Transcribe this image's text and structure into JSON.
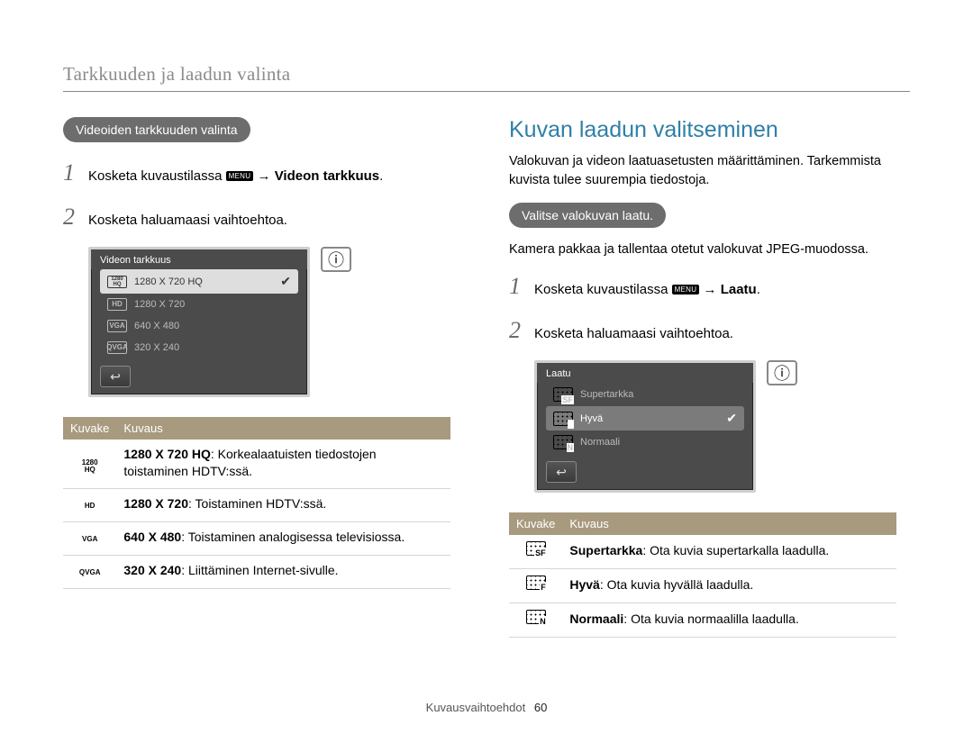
{
  "breadcrumb": "Tarkkuuden ja laadun valinta",
  "left": {
    "pill": "Videoiden tarkkuuden valinta",
    "step1_pre": "Kosketa kuvaustilassa ",
    "step1_menu": "MENU",
    "step1_post": " → ",
    "step1_bold": "Videon tarkkuus",
    "step1_end": ".",
    "step2": "Kosketa haluamaasi vaihtoehtoa.",
    "mock": {
      "title": "Videon tarkkuus",
      "rows": [
        {
          "icon_top": "1280",
          "icon_bot": "HQ",
          "label": "1280 X 720 HQ",
          "selected": true,
          "check": true
        },
        {
          "icon": "HD",
          "label": "1280 X 720"
        },
        {
          "icon": "VGA",
          "label": "640 X 480"
        },
        {
          "icon": "QVGA",
          "label": "320 X 240"
        }
      ]
    },
    "table": {
      "th_icon": "Kuvake",
      "th_desc": "Kuvaus",
      "rows": [
        {
          "icon_top": "1280",
          "icon_bot": "HQ",
          "bold": "1280 X 720 HQ",
          "rest": ": Korkealaatuisten tiedostojen toistaminen HDTV:ssä."
        },
        {
          "icon": "HD",
          "bold": "1280 X 720",
          "rest": ": Toistaminen HDTV:ssä."
        },
        {
          "icon": "VGA",
          "bold": "640 X 480",
          "rest": ": Toistaminen analogisessa televisiossa."
        },
        {
          "icon": "QVGA",
          "bold": "320 X 240",
          "rest": ": Liittäminen Internet-sivulle."
        }
      ]
    }
  },
  "right": {
    "title": "Kuvan laadun valitseminen",
    "intro": "Valokuvan ja videon laatuasetusten määrittäminen. Tarkemmista kuvista tulee suurempia tiedostoja.",
    "pill": "Valitse valokuvan laatu.",
    "note": "Kamera pakkaa ja tallentaa otetut valokuvat JPEG-muodossa.",
    "step1_pre": "Kosketa kuvaustilassa ",
    "step1_menu": "MENU",
    "step1_post": " → ",
    "step1_bold": "Laatu",
    "step1_end": ".",
    "step2": "Kosketa haluamaasi vaihtoehtoa.",
    "mock": {
      "title": "Laatu",
      "rows": [
        {
          "letter": "SF",
          "label": "Supertarkka"
        },
        {
          "letter": "F",
          "label": "Hyvä",
          "hl": true,
          "check": true
        },
        {
          "letter": "N",
          "label": "Normaali"
        }
      ]
    },
    "table": {
      "th_icon": "Kuvake",
      "th_desc": "Kuvaus",
      "rows": [
        {
          "letter": "SF",
          "bold": "Supertarkka",
          "rest": ": Ota kuvia supertarkalla laadulla."
        },
        {
          "letter": "F",
          "bold": "Hyvä",
          "rest": ": Ota kuvia hyvällä laadulla."
        },
        {
          "letter": "N",
          "bold": "Normaali",
          "rest": ": Ota kuvia normaalilla laadulla."
        }
      ]
    }
  },
  "footer": {
    "section": "Kuvausvaihtoehdot",
    "page": "60"
  }
}
